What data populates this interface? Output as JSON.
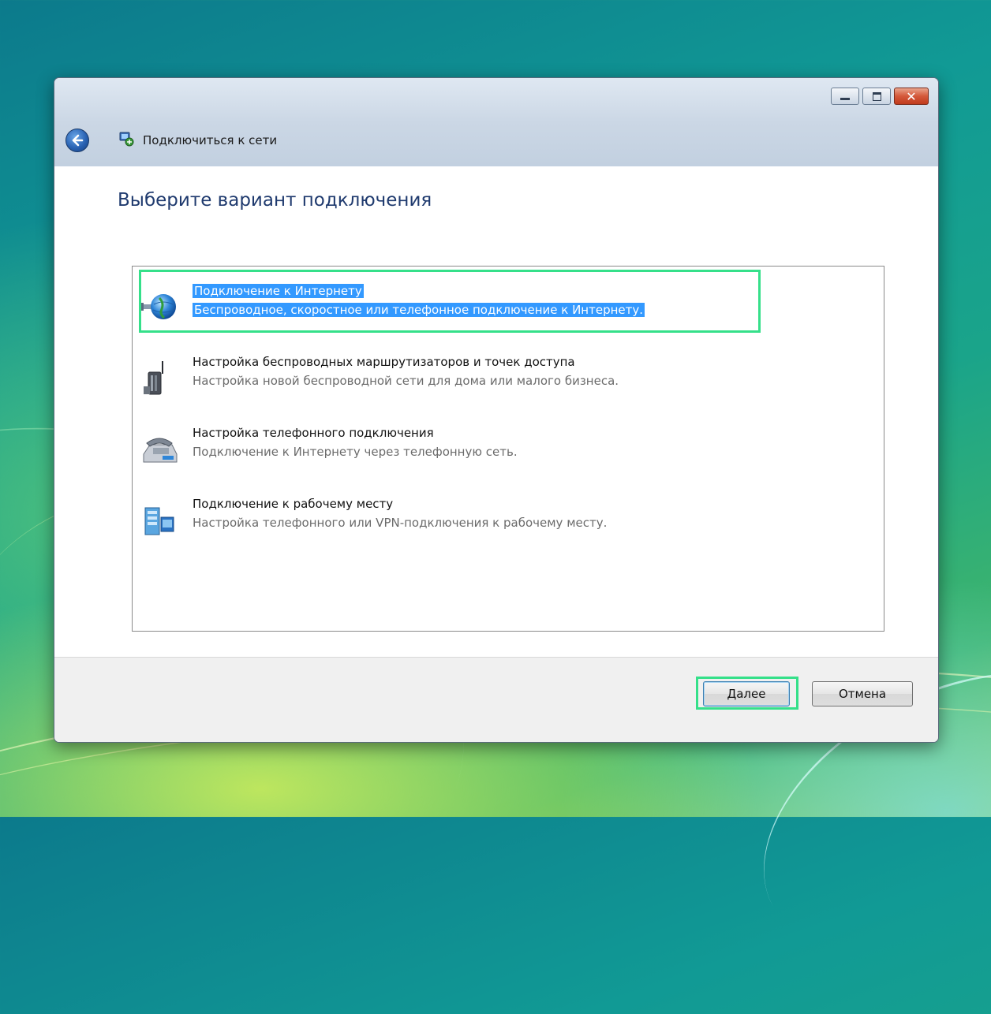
{
  "window": {
    "title": "Подключиться к сети",
    "minimize_icon": "minimize-icon",
    "maximize_icon": "maximize-icon",
    "close_icon": "close-icon",
    "close_glyph": "✕"
  },
  "content": {
    "heading": "Выберите вариант подключения",
    "options": [
      {
        "title": "Подключение к Интернету",
        "description": "Беспроводное, скоростное или телефонное подключение к Интернету.",
        "icon": "globe-connection-icon",
        "selected": true
      },
      {
        "title": "Настройка беспроводных маршрутизаторов и точек доступа",
        "description": "Настройка новой беспроводной сети для дома или малого бизнеса.",
        "icon": "wireless-router-icon",
        "selected": false
      },
      {
        "title": "Настройка телефонного подключения",
        "description": "Подключение к Интернету через телефонную сеть.",
        "icon": "telephone-modem-icon",
        "selected": false
      },
      {
        "title": "Подключение к рабочему месту",
        "description": "Настройка телефонного или VPN-подключения к рабочему месту.",
        "icon": "workplace-network-icon",
        "selected": false
      }
    ]
  },
  "footer": {
    "next_label": "Далее",
    "cancel_label": "Отмена"
  },
  "colors": {
    "selection": "#3399ff",
    "highlight_annotation": "#35e08a",
    "heading": "#1f3a6e"
  }
}
